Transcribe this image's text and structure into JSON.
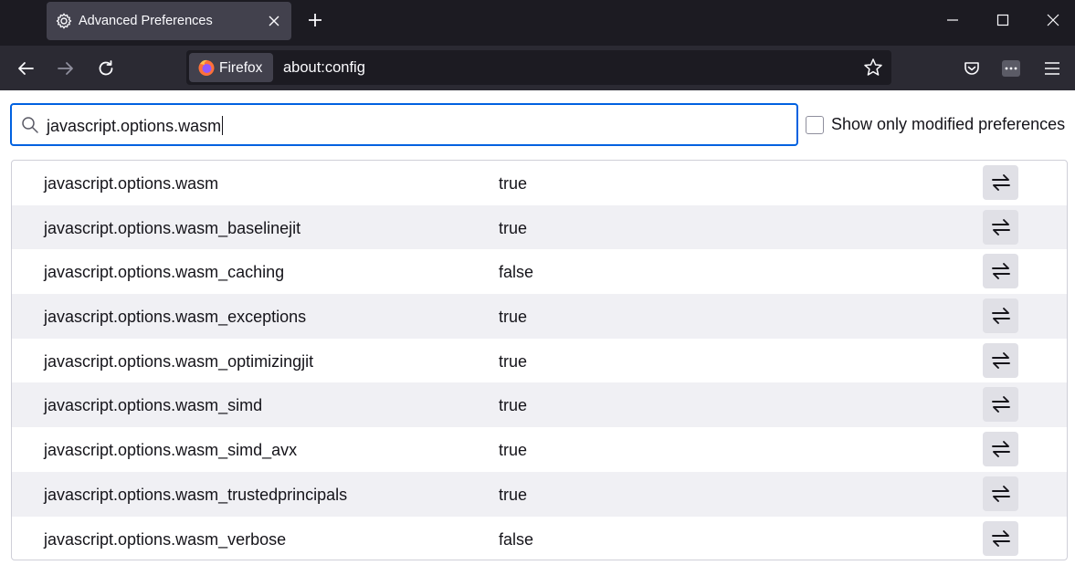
{
  "tab": {
    "title": "Advanced Preferences",
    "icon": "gear-icon"
  },
  "nav": {
    "identity_label": "Firefox",
    "url": "about:config"
  },
  "search": {
    "value": "javascript.options.wasm"
  },
  "modified_filter": {
    "label": "Show only modified preferences",
    "checked": false
  },
  "preferences": [
    {
      "name": "javascript.options.wasm",
      "value": "true"
    },
    {
      "name": "javascript.options.wasm_baselinejit",
      "value": "true"
    },
    {
      "name": "javascript.options.wasm_caching",
      "value": "false"
    },
    {
      "name": "javascript.options.wasm_exceptions",
      "value": "true"
    },
    {
      "name": "javascript.options.wasm_optimizingjit",
      "value": "true"
    },
    {
      "name": "javascript.options.wasm_simd",
      "value": "true"
    },
    {
      "name": "javascript.options.wasm_simd_avx",
      "value": "true"
    },
    {
      "name": "javascript.options.wasm_trustedprincipals",
      "value": "true"
    },
    {
      "name": "javascript.options.wasm_verbose",
      "value": "false"
    }
  ],
  "colors": {
    "tabstrip": "#1c1b22",
    "toolbar": "#2b2a33",
    "accent": "#0061e0"
  }
}
